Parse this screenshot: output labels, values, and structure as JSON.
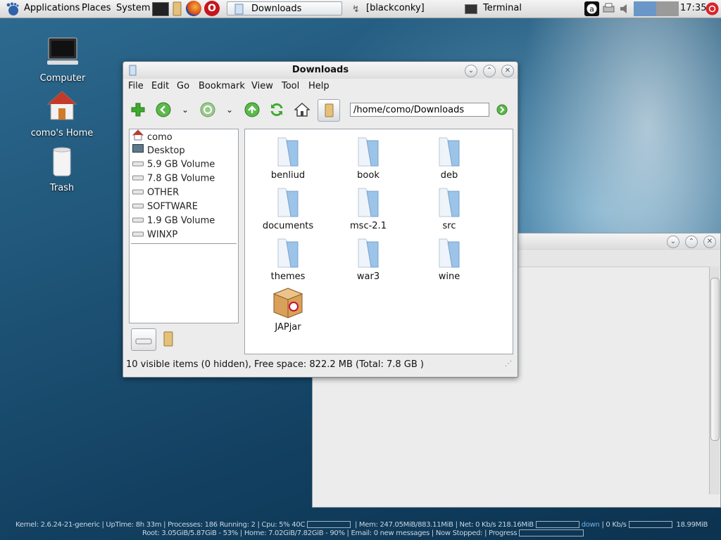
{
  "top_panel": {
    "menus": [
      "Applications",
      "Places",
      "System"
    ],
    "tasks": [
      {
        "label": "Downloads",
        "active": true
      },
      {
        "label": "[blackconky]",
        "active": false
      },
      {
        "label": "Terminal",
        "active": false
      }
    ],
    "clock": "17:35"
  },
  "desktop_icons": [
    {
      "label": "Computer",
      "icon": "computer-icon"
    },
    {
      "label": "como's Home",
      "icon": "home-icon"
    },
    {
      "label": "Trash",
      "icon": "trash-icon"
    }
  ],
  "window": {
    "title": "Downloads",
    "menu": [
      "File",
      "Edit",
      "Go",
      "Bookmark",
      "View",
      "Tool",
      "Help"
    ],
    "path": "/home/como/Downloads",
    "sidebar": [
      {
        "label": "como",
        "icon": "home-icon"
      },
      {
        "label": "Desktop",
        "icon": "desktop-icon"
      },
      {
        "label": "5.9 GB Volume",
        "icon": "drive-icon"
      },
      {
        "label": "7.8 GB Volume",
        "icon": "drive-icon"
      },
      {
        "label": "OTHER",
        "icon": "drive-icon"
      },
      {
        "label": "SOFTWARE",
        "icon": "drive-icon"
      },
      {
        "label": "1.9 GB Volume",
        "icon": "drive-icon"
      },
      {
        "label": "WINXP",
        "icon": "drive-icon"
      }
    ],
    "files": [
      {
        "name": "benliud",
        "type": "folder"
      },
      {
        "name": "book",
        "type": "folder"
      },
      {
        "name": "deb",
        "type": "folder"
      },
      {
        "name": "documents",
        "type": "folder"
      },
      {
        "name": "msc-2.1",
        "type": "folder"
      },
      {
        "name": "src",
        "type": "folder"
      },
      {
        "name": "themes",
        "type": "folder"
      },
      {
        "name": "war3",
        "type": "folder"
      },
      {
        "name": "wine",
        "type": "folder"
      },
      {
        "name": "JAPjar",
        "type": "package"
      }
    ],
    "status": "10 visible items (0 hidden), Free space: 822.2 MB (Total: 7.8 GB )"
  },
  "conky": {
    "row1": {
      "kernel": "Kernel: 2.6.24-21-generic",
      "uptime": "UpTime: 8h 33m",
      "processes": "Processes: 186  Running: 2",
      "cpu": "Cpu: 5% 40C",
      "mem": "Mem: 247.05MiB/883.11MiB",
      "net": "Net: 0 Kb/s  218.16MiB",
      "down": "down",
      "up": "0 Kb/s",
      "up_total": "18.99MiB"
    },
    "row2": {
      "root": "Root: 3.05GiB/5.87GiB - 53%",
      "home": "Home: 7.02GiB/7.82GiB - 90%",
      "email": "Email: 0 new messages",
      "now": "Now Stopped:",
      "progress": "Progress"
    }
  },
  "colors": {
    "folder": "#9cc3e8",
    "accent_green": "#3faa2e"
  }
}
